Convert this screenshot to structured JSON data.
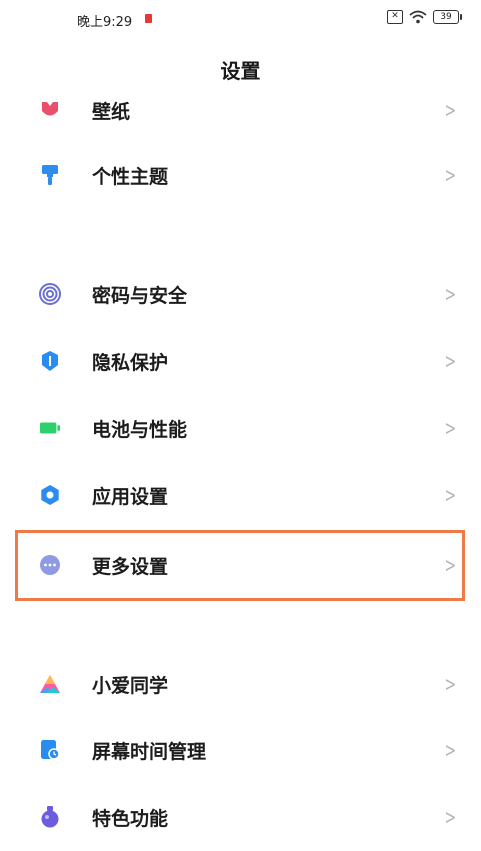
{
  "status_bar": {
    "time": "晚上9:29",
    "battery_level": "39"
  },
  "header": {
    "title": "设置"
  },
  "sections": [
    {
      "items": [
        {
          "label": "壁纸",
          "icon": "wallpaper-icon",
          "icon_color": "#e8506b"
        },
        {
          "label": "个性主题",
          "icon": "theme-brush-icon",
          "icon_color": "#2f8df0"
        }
      ]
    },
    {
      "items": [
        {
          "label": "密码与安全",
          "icon": "fingerprint-icon",
          "icon_color": "#6b6fd8"
        },
        {
          "label": "隐私保护",
          "icon": "privacy-shield-icon",
          "icon_color": "#2b8cf0"
        },
        {
          "label": "电池与性能",
          "icon": "battery-icon",
          "icon_color": "#2ed06e"
        },
        {
          "label": "应用设置",
          "icon": "gear-icon",
          "icon_color": "#2b8cf0"
        },
        {
          "label": "更多设置",
          "icon": "more-dots-icon",
          "icon_color": "#8e9be4"
        }
      ]
    },
    {
      "items": [
        {
          "label": "小爱同学",
          "icon": "xiaoai-icon",
          "icon_color": "#ff5a9e"
        },
        {
          "label": "屏幕时间管理",
          "icon": "screen-time-icon",
          "icon_color": "#2b8cf0"
        },
        {
          "label": "特色功能",
          "icon": "special-features-icon",
          "icon_color": "#6b5ce0"
        }
      ]
    }
  ],
  "highlight_color": "#ee7a45"
}
